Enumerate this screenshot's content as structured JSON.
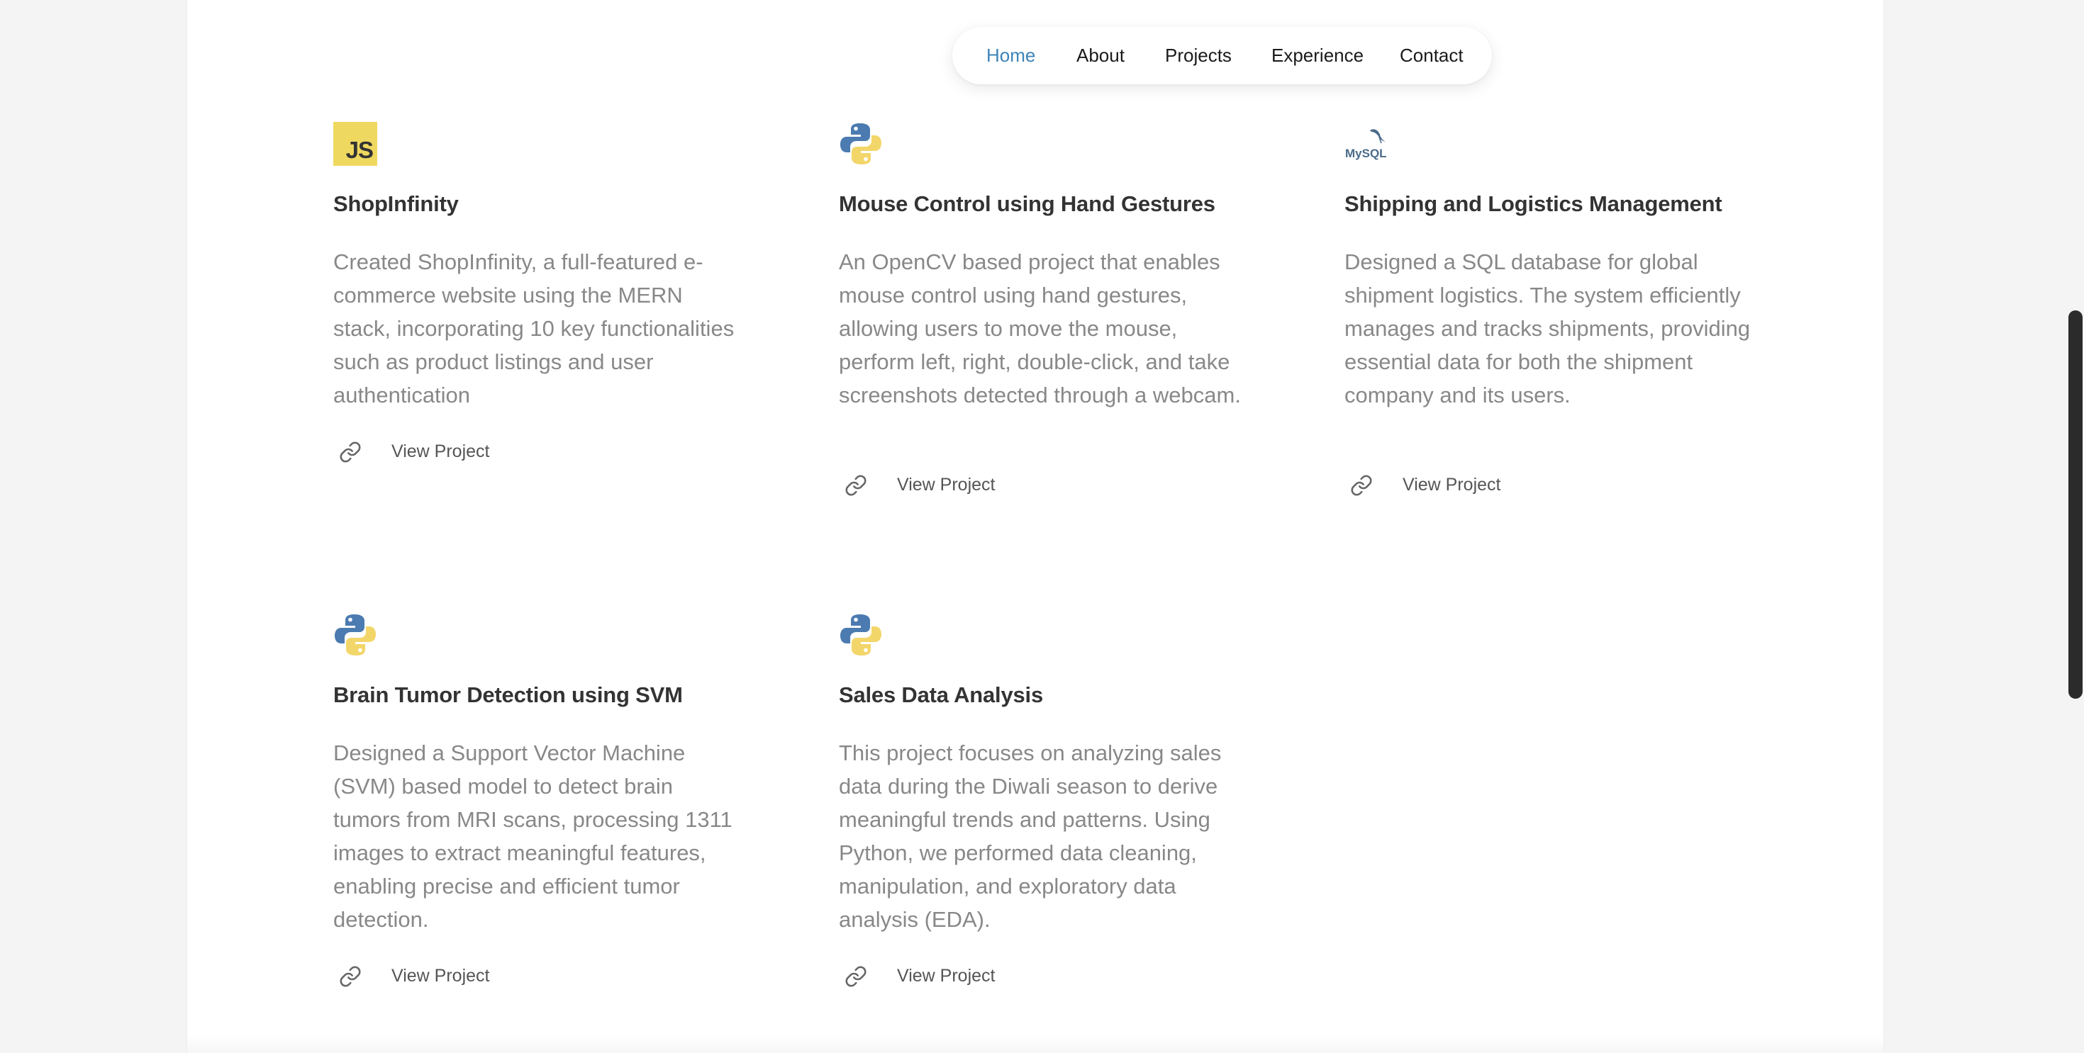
{
  "nav": {
    "items": [
      {
        "label": "Home",
        "active": true
      },
      {
        "label": "About",
        "active": false
      },
      {
        "label": "Projects",
        "active": false
      },
      {
        "label": "Experience",
        "active": false
      },
      {
        "label": "Contact",
        "active": false
      }
    ],
    "active_color": "#3d84b8"
  },
  "projects": [
    {
      "icon": "javascript-icon",
      "icon_text": "JS",
      "title": "ShopInfinity",
      "description": "Created ShopInfinity, a full-featured e-commerce website using the MERN stack, incorporating 10 key functionalities such as product listings and user authentication",
      "link_label": "View Project"
    },
    {
      "icon": "python-icon",
      "title": "Mouse Control using Hand Gestures",
      "description": "An OpenCV based project that enables mouse control using hand gestures, allowing users to move the mouse, perform left, right, double-click, and take screenshots detected through a webcam.",
      "link_label": "View Project"
    },
    {
      "icon": "mysql-icon",
      "icon_text": "MySQL",
      "title": "Shipping and Logistics Management",
      "description": "Designed a SQL database for global shipment logistics. The system efficiently manages and tracks shipments, providing essential data for both the shipment company and its users.",
      "link_label": "View Project"
    },
    {
      "icon": "python-icon",
      "title": "Brain Tumor Detection using SVM",
      "description": "Designed a Support Vector Machine (SVM) based model to detect brain tumors from MRI scans, processing 1311 images to extract meaningful features, enabling precise and efficient tumor detection.",
      "link_label": "View Project"
    },
    {
      "icon": "python-icon",
      "title": "Sales Data Analysis",
      "description": "This project focuses on analyzing sales data during the Diwali season to derive meaningful trends and patterns. Using Python, we performed data cleaning, manipulation, and exploratory data analysis (EDA).",
      "link_label": "View Project"
    }
  ],
  "colors": {
    "title": "#333333",
    "description": "#888888",
    "js_badge": "#efd85f",
    "python_blue": "#4b7bb0",
    "python_yellow": "#f3d66a",
    "mysql_blue": "#4b6b8a",
    "mysql_orange": "#e48e00"
  }
}
